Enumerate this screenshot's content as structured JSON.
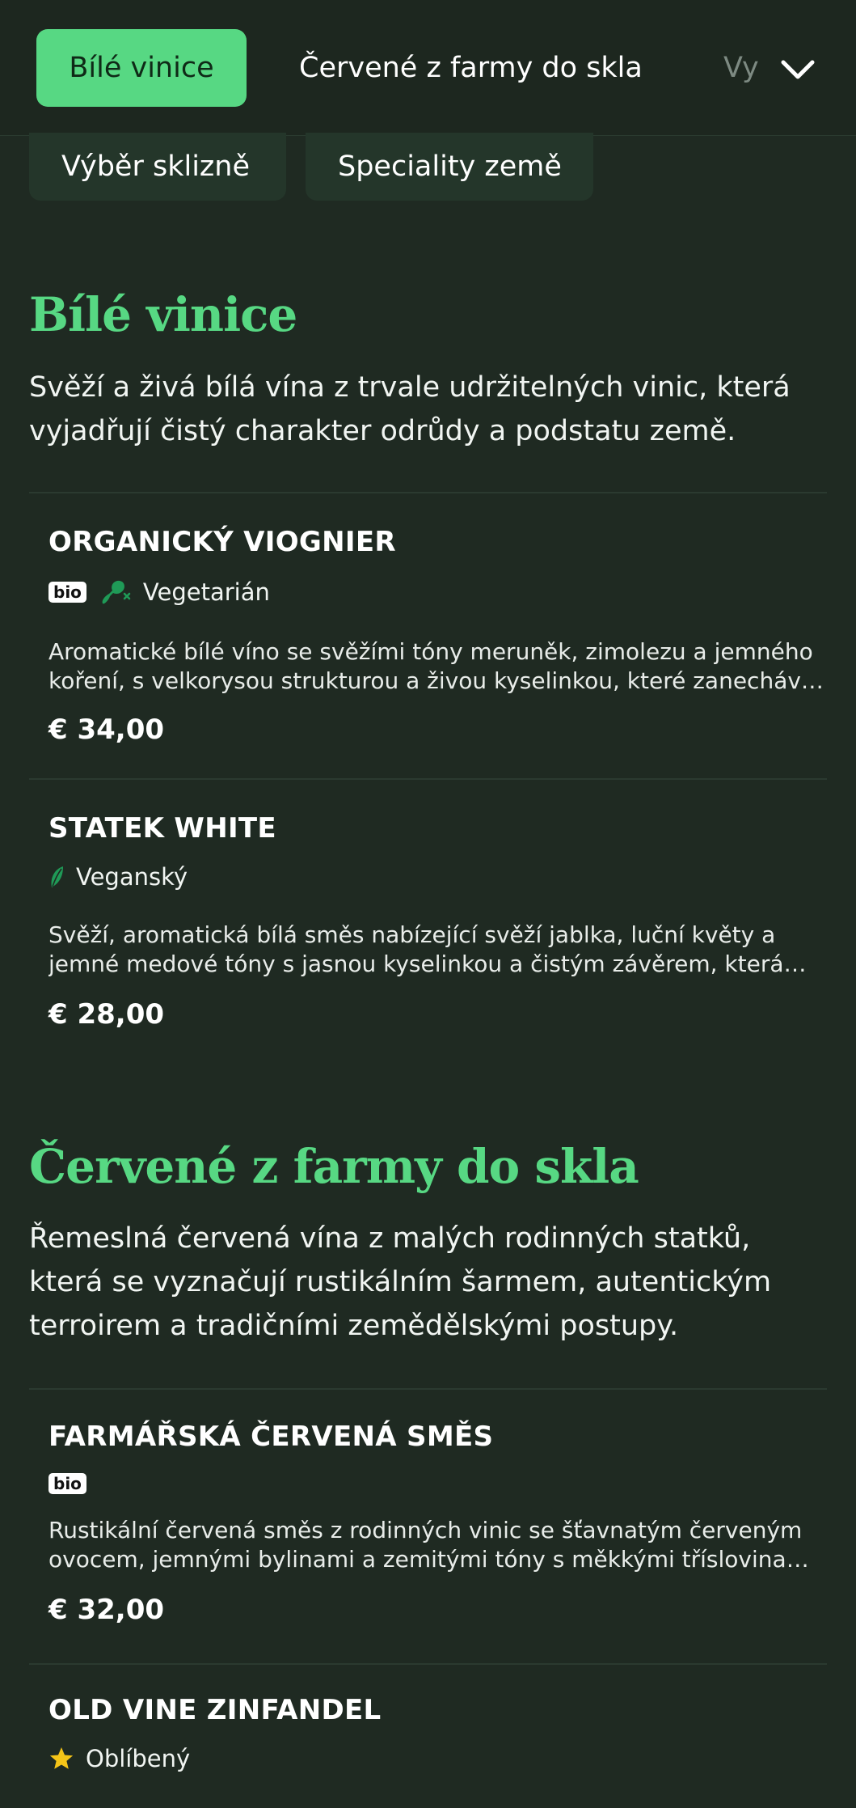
{
  "nav": {
    "tabs": [
      {
        "label": "Bílé vinice",
        "active": true
      },
      {
        "label": "Červené z farmy do skla",
        "active": false
      },
      {
        "label": "Vy",
        "active": false
      }
    ],
    "more_icon": "chevron-down-icon",
    "secondary_tabs": [
      {
        "label": "Výběr sklizně"
      },
      {
        "label": "Speciality země"
      }
    ]
  },
  "colors": {
    "accent": "#57d883",
    "background": "#1f2a22",
    "leaf": "#1f9a57"
  },
  "sections": [
    {
      "title": "Bílé vinice",
      "description": "Svěží a živá bílá vína z trvale udržitelných vinic, která vyjadřují čistý charakter odrůdy a podstatu země.",
      "items": [
        {
          "name": "ORGANICKÝ VIOGNIER",
          "badges": [
            "bio"
          ],
          "diet_icon": "no-meat-icon",
          "diet_label": "Vegetarián",
          "description": "Aromatické bílé víno se svěžími tóny meruněk, zimolezu a jemného koření, s velkorysou strukturou a živou kyselinkou, které zanechává dlouhý a svěží dojem.",
          "price": "€ 34,00"
        },
        {
          "name": "STATEK WHITE",
          "badges": [],
          "diet_icon": "leaf-icon",
          "diet_label": "Veganský",
          "description": "Svěží, aromatická bílá směs nabízející svěží jablka, luční květy a jemné medové tóny s jasnou kyselinkou a čistým závěrem, která vyniká ke všemu.",
          "price": "€ 28,00"
        }
      ]
    },
    {
      "title": "Červené z farmy do skla",
      "description": "Řemeslná červená vína z malých rodinných statků, která se vyznačují rustikálním šarmem, autentickým terroirem a tradičními zemědělskými postupy.",
      "items": [
        {
          "name": "FARMÁŘSKÁ ČERVENÁ SMĚS",
          "badges": [
            "bio"
          ],
          "description": "Rustikální červená směs z rodinných vinic se šťavnatým červeným ovocem, jemnými bylinami a zemitými tóny s měkkými tříslovinami a hladkým závěrem.",
          "price": "€ 32,00"
        },
        {
          "name": "OLD VINE ZINFANDEL",
          "badges": [],
          "diet_icon": "star-icon",
          "diet_label": "Oblíbený"
        }
      ]
    }
  ]
}
